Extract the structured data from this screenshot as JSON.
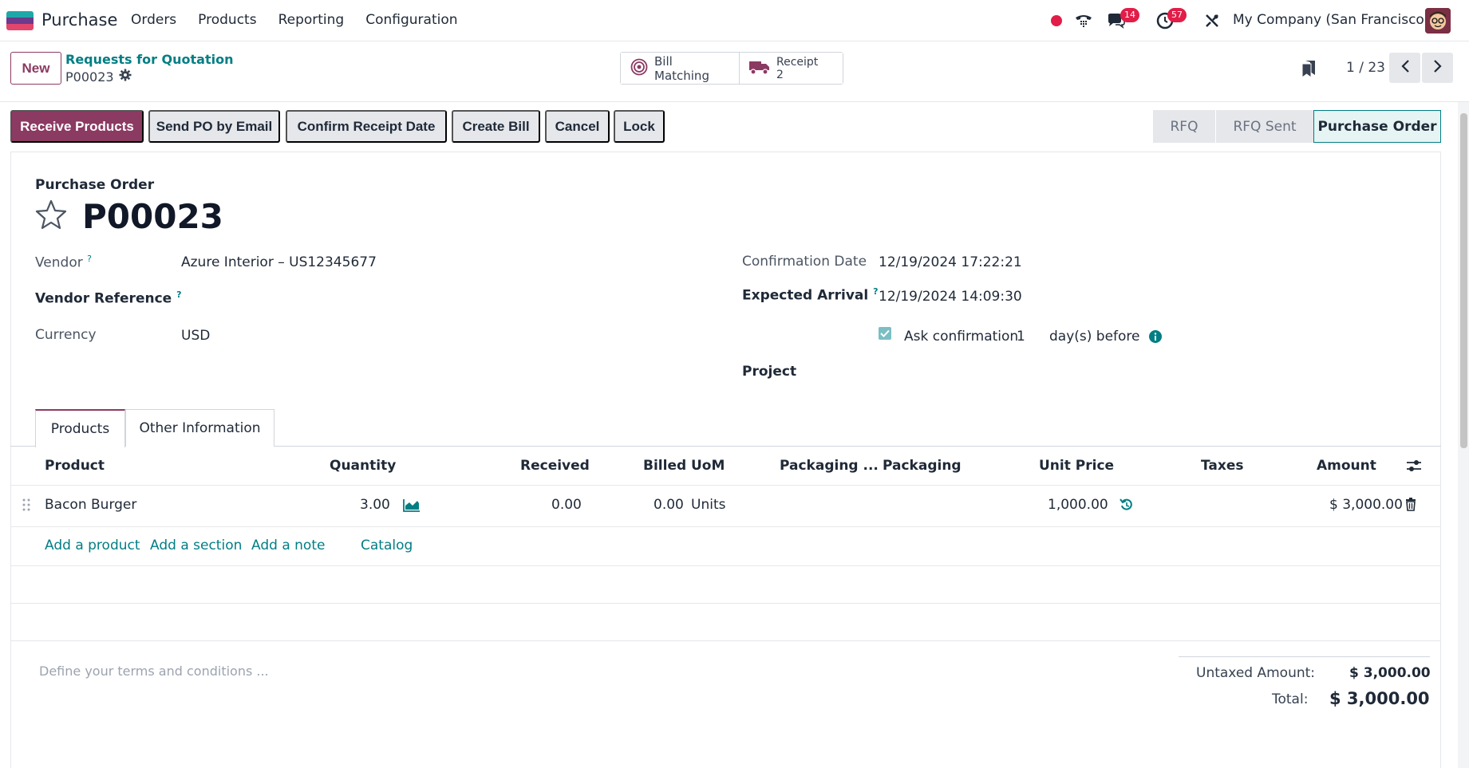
{
  "navbar": {
    "app_name": "Purchase",
    "menu": [
      "Orders",
      "Products",
      "Reporting",
      "Configuration"
    ],
    "chat_badge": "14",
    "activity_badge": "57",
    "company": "My Company (San Francisco)"
  },
  "control": {
    "new_label": "New",
    "breadcrumb_parent": "Requests for Quotation",
    "breadcrumb_current": "P00023",
    "smart": {
      "bill_matching": "Bill Matching",
      "receipt_label": "Receipt",
      "receipt_count": "2"
    },
    "pager": "1 / 23"
  },
  "actions": {
    "receive": "Receive Products",
    "send_email": "Send PO by Email",
    "confirm_receipt": "Confirm Receipt Date",
    "create_bill": "Create Bill",
    "cancel": "Cancel",
    "lock": "Lock"
  },
  "stages": [
    "RFQ",
    "RFQ Sent",
    "Purchase Order"
  ],
  "form": {
    "doc_type": "Purchase Order",
    "doc_name": "P00023",
    "vendor_label": "Vendor",
    "vendor_value": "Azure Interior – US12345677",
    "vendor_ref_label": "Vendor Reference",
    "currency_label": "Currency",
    "currency_value": "USD",
    "confirmation_date_label": "Confirmation Date",
    "confirmation_date_value": "12/19/2024 17:22:21",
    "expected_arrival_label": "Expected Arrival",
    "expected_arrival_value": "12/19/2024 14:09:30",
    "ask_confirmation_label": "Ask confirmation",
    "ask_confirmation_days": "1",
    "days_before": "day(s) before",
    "project_label": "Project",
    "help_mark": "?"
  },
  "tabs": [
    "Products",
    "Other Information"
  ],
  "table": {
    "headers": {
      "product": "Product",
      "quantity": "Quantity",
      "received": "Received",
      "billed": "Billed",
      "uom": "UoM",
      "packaging_qty": "Packaging ...",
      "packaging": "Packaging",
      "unit_price": "Unit Price",
      "taxes": "Taxes",
      "amount": "Amount"
    },
    "row": {
      "product": "Bacon Burger",
      "quantity": "3.00",
      "received": "0.00",
      "billed": "0.00",
      "uom": "Units",
      "unit_price": "1,000.00",
      "amount": "$ 3,000.00"
    },
    "add_links": {
      "add_product": "Add a product",
      "add_section": "Add a section",
      "add_note": "Add a note",
      "catalog": "Catalog"
    }
  },
  "footer": {
    "terms_placeholder": "Define your terms and conditions ...",
    "untaxed_label": "Untaxed Amount:",
    "untaxed_value": "$ 3,000.00",
    "total_label": "Total:",
    "total_value": "$ 3,000.00"
  },
  "colors": {
    "primary": "#8b3a62",
    "link": "#017e84",
    "badge": "#e11d48"
  }
}
